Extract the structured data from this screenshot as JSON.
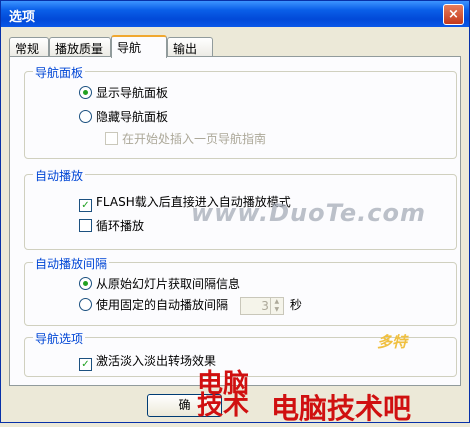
{
  "window": {
    "title": "选项",
    "close_glyph": "×"
  },
  "tabs": [
    "常规",
    "播放质量",
    "导航",
    "输出"
  ],
  "groups": {
    "nav_panel": {
      "title": "导航面板",
      "show": "显示导航面板",
      "hide": "隐藏导航面板",
      "insert_guide": "在开始处插入一页导航指南"
    },
    "autoplay": {
      "title": "自动播放",
      "flash_autoplay": "FLASH载入后直接进入自动播放模式",
      "loop": "循环播放"
    },
    "interval": {
      "title": "自动播放间隔",
      "from_original": "从原始幻灯片获取间隔信息",
      "fixed": "使用固定的自动播放间隔",
      "value": "3",
      "unit": "秒"
    },
    "nav_options": {
      "title": "导航选项",
      "fade": "激活淡入淡出转场效果"
    }
  },
  "buttons": {
    "ok": "确"
  },
  "watermark": {
    "site": "www.DuoTe.com",
    "logo_left_1": "电脑",
    "logo_left_2": "技术",
    "logo_right": "电脑技术吧",
    "logo_mark": "多特"
  }
}
